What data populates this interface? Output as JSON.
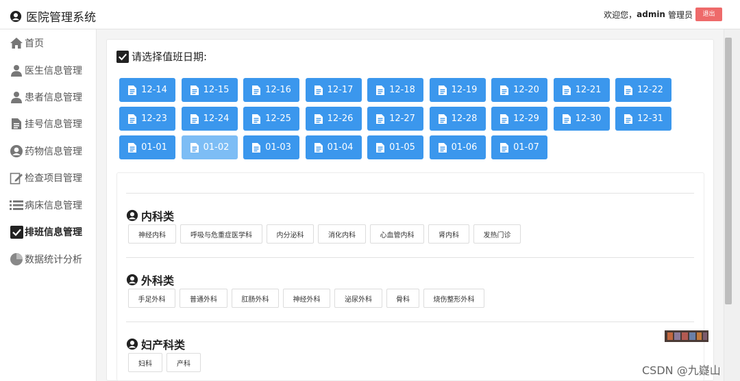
{
  "app": {
    "title": "医院管理系统"
  },
  "header": {
    "welcome": "欢迎您，",
    "username": "admin",
    "role": "管理员",
    "logout_label": "退出"
  },
  "sidebar": {
    "items": [
      {
        "label": "首页",
        "icon": "home-icon"
      },
      {
        "label": "医生信息管理",
        "icon": "doctor-icon"
      },
      {
        "label": "患者信息管理",
        "icon": "patient-icon"
      },
      {
        "label": "挂号信息管理",
        "icon": "document-icon"
      },
      {
        "label": "药物信息管理",
        "icon": "medicine-icon"
      },
      {
        "label": "检查项目管理",
        "icon": "edit-icon"
      },
      {
        "label": "病床信息管理",
        "icon": "list-icon"
      },
      {
        "label": "排班信息管理",
        "icon": "checkbox-icon",
        "active": true
      },
      {
        "label": "数据统计分析",
        "icon": "chart-icon"
      }
    ]
  },
  "schedule": {
    "title": "请选择值班日期:",
    "selected_date": "01-02",
    "dates": [
      "12-14",
      "12-15",
      "12-16",
      "12-17",
      "12-18",
      "12-19",
      "12-20",
      "12-21",
      "12-22",
      "12-23",
      "12-24",
      "12-25",
      "12-26",
      "12-27",
      "12-28",
      "12-29",
      "12-30",
      "12-31",
      "01-01",
      "01-02",
      "01-03",
      "01-04",
      "01-05",
      "01-06",
      "01-07"
    ]
  },
  "departments": [
    {
      "title": "内科类",
      "items": [
        "神经内科",
        "呼吸与危重症医学科",
        "内分泌科",
        "消化内科",
        "心血管内科",
        "肾内科",
        "发热门诊"
      ]
    },
    {
      "title": "外科类",
      "items": [
        "手足外科",
        "普通外科",
        "肛肠外科",
        "神经外科",
        "泌尿外科",
        "骨科",
        "烧伤整形外科"
      ]
    },
    {
      "title": "妇产科类",
      "items": [
        "妇科",
        "产科"
      ]
    }
  ],
  "watermark": "CSDN @九嶷山",
  "colors": {
    "primary": "#3b97ed",
    "selected": "#7dbdf5",
    "logout": "#ee6a6a"
  }
}
